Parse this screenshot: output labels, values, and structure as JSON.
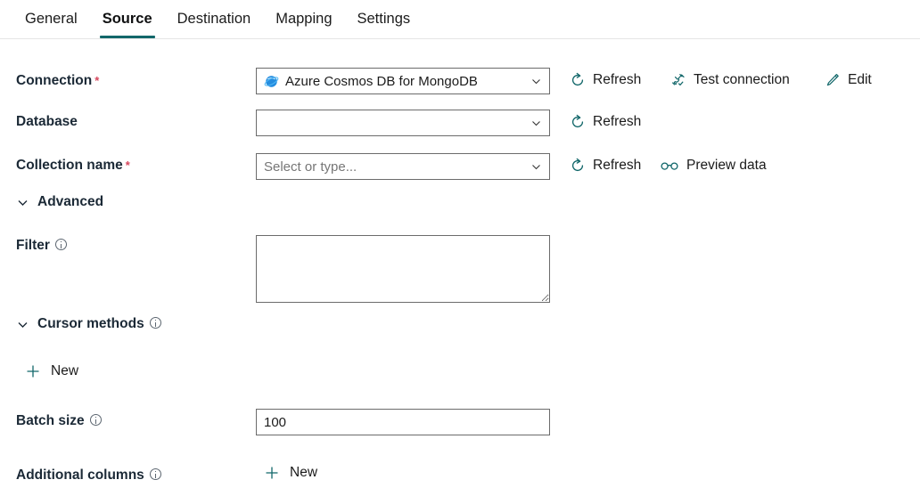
{
  "tabs": [
    {
      "label": "General",
      "active": false
    },
    {
      "label": "Source",
      "active": true
    },
    {
      "label": "Destination",
      "active": false
    },
    {
      "label": "Mapping",
      "active": false
    },
    {
      "label": "Settings",
      "active": false
    }
  ],
  "theme": {
    "accent_teal": "#12676a",
    "required_red": "#d6465c",
    "label_color": "#1b2936",
    "border_color": "#6b6b6b",
    "placeholder_color": "#767676"
  },
  "form": {
    "connection": {
      "label": "Connection",
      "required": "*",
      "value": "Azure Cosmos DB for MongoDB",
      "icon": "cosmos-db-icon",
      "actions": {
        "refresh": "Refresh",
        "test_connection": "Test connection",
        "edit": "Edit"
      }
    },
    "database": {
      "label": "Database",
      "value": "",
      "placeholder": "",
      "actions": {
        "refresh": "Refresh"
      }
    },
    "collection_name": {
      "label": "Collection name",
      "required": "*",
      "value": "",
      "placeholder": "Select or type...",
      "actions": {
        "refresh": "Refresh",
        "preview_data": "Preview data"
      }
    },
    "advanced": {
      "label": "Advanced",
      "expanded": true
    },
    "filter": {
      "label": "Filter",
      "value": "",
      "placeholder": ""
    },
    "cursor_methods": {
      "label": "Cursor methods",
      "expanded": true,
      "new_label": "New"
    },
    "batch_size": {
      "label": "Batch size",
      "value": "100"
    },
    "additional_columns": {
      "label": "Additional columns",
      "new_label": "New"
    }
  }
}
